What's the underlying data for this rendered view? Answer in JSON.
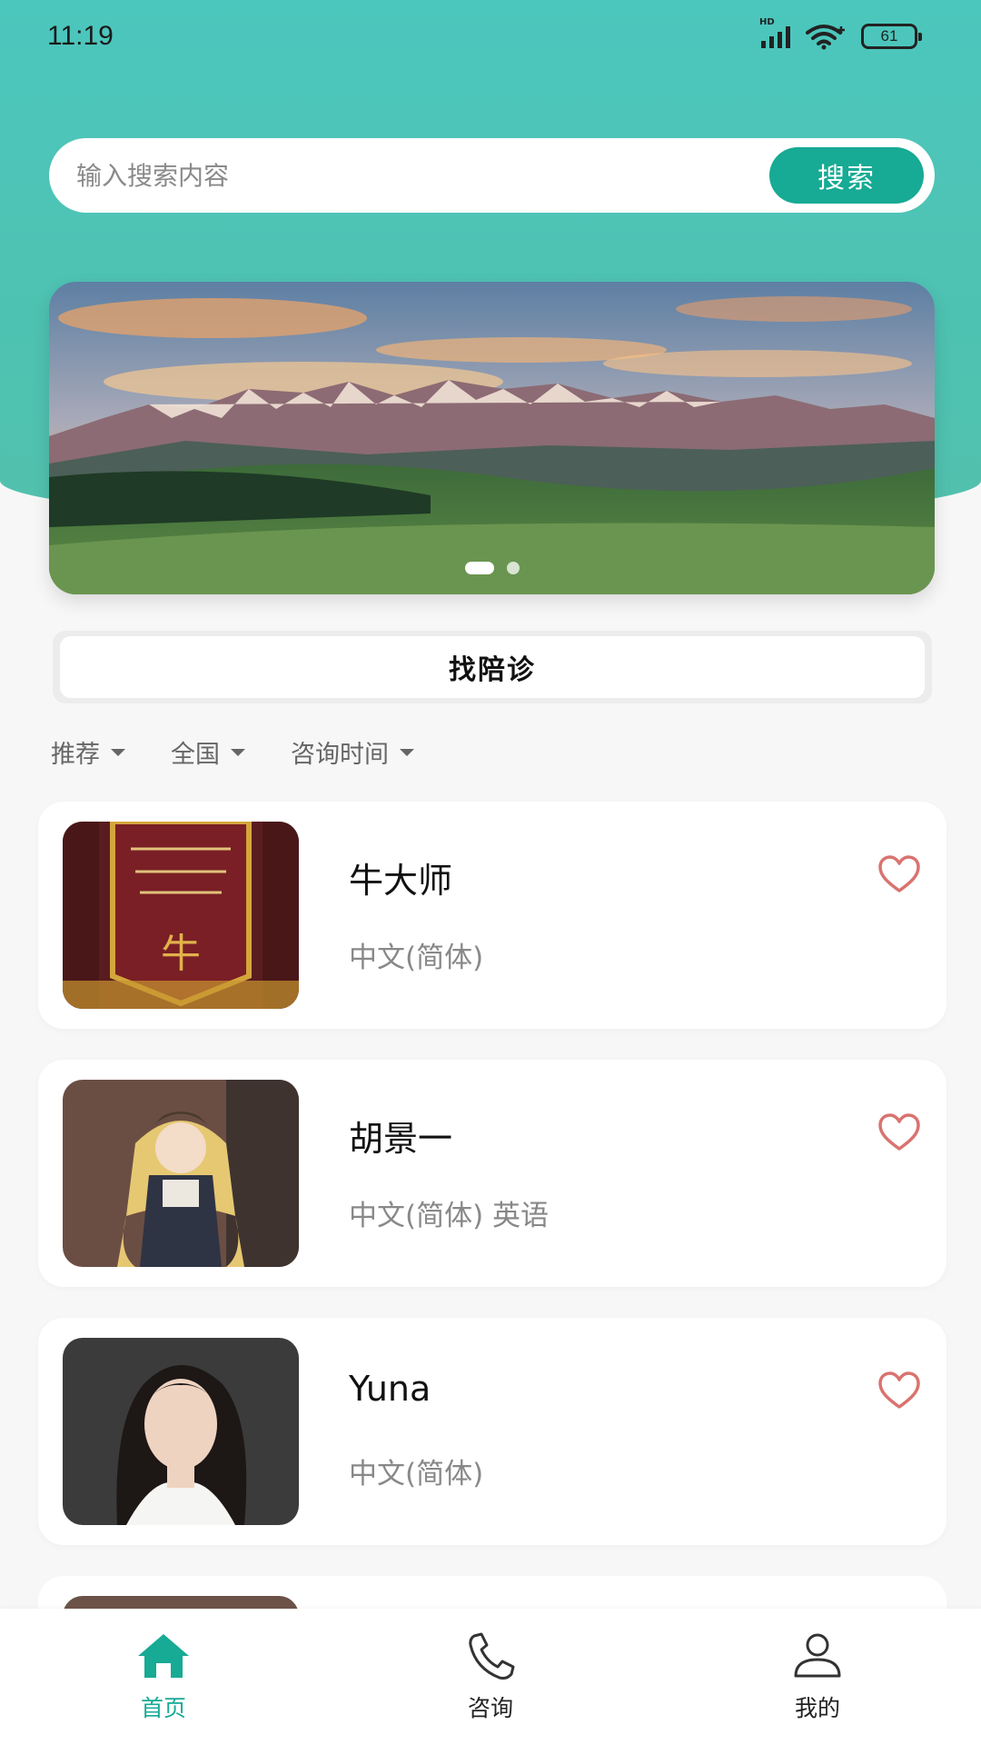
{
  "status_bar": {
    "time": "11:19",
    "signal_label": "HD",
    "battery": "61"
  },
  "search": {
    "placeholder": "输入搜索内容",
    "button_label": "搜索"
  },
  "banner": {
    "image": "mountain-landscape-photo",
    "slide_count": 2,
    "active_slide": 1
  },
  "find_button_label": "找陪诊",
  "filters": [
    {
      "label": "推荐"
    },
    {
      "label": "全国"
    },
    {
      "label": "咨询时间"
    }
  ],
  "companions": [
    {
      "name": "牛大师",
      "languages": "中文(简体)",
      "photo": "red-pennant-banner-photo",
      "favorite_icon": "heart-outline-icon"
    },
    {
      "name": "胡景一",
      "languages": "中文(简体) 英语",
      "photo": "anime-character-figure-photo",
      "favorite_icon": "heart-outline-icon"
    },
    {
      "name": "Yuna",
      "languages": "中文(简体)",
      "photo": "woman-portrait-photo",
      "favorite_icon": "heart-outline-icon"
    }
  ],
  "tabs": [
    {
      "label": "首页",
      "icon": "home-icon",
      "active": true
    },
    {
      "label": "咨询",
      "icon": "phone-icon",
      "active": false
    },
    {
      "label": "我的",
      "icon": "user-icon",
      "active": false
    }
  ],
  "colors": {
    "accent": "#17aa94",
    "header_bg": "#4cc7bd",
    "heart": "#d9736f"
  }
}
